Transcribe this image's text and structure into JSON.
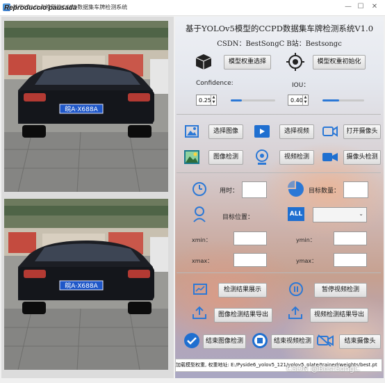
{
  "window": {
    "title": "基于YOLOv5模型的CCPD数据集车牌检测系统",
    "overlay_status": "Reproduccio pausada",
    "controls": {
      "minimize": "—",
      "maximize": "☐",
      "close": "✕"
    }
  },
  "header": {
    "title": "基于YOLOv5模型的CCPD数据集车牌检测系统V1.0",
    "credits": "CSDN：BestSongC   B站：Bestsongc"
  },
  "model": {
    "select_weights_label": "模型权重选择",
    "init_weights_label": "模型权重初始化",
    "confidence_label": "Confidence:",
    "confidence_value": "0.25",
    "confidence_fraction": 0.25,
    "iou_label": "IOU：",
    "iou_value": "0.40",
    "iou_fraction": 0.4
  },
  "source_buttons": {
    "select_image": "选择图像",
    "select_video": "选择视频",
    "open_camera": "打开摄像头",
    "image_detect": "图像检测",
    "video_detect": "视频检测",
    "camera_detect": "摄像头检测"
  },
  "stats": {
    "time_label": "用时：",
    "count_label": "目标数量：",
    "position_label": "目标位置：",
    "all_text": "ALL",
    "combo_value": "",
    "xmin_label": "xmin：",
    "ymin_label": "ymin：",
    "xmax_label": "xmax：",
    "ymax_label": "ymax："
  },
  "actions": {
    "show_results": "检测结果展示",
    "pause_video": "暂停视频检测",
    "export_image": "图像检测结果导出",
    "export_video": "视频检测结果导出",
    "end_image": "结束图像检测",
    "end_video": "结束视频检测",
    "end_camera": "结束摄像头"
  },
  "images": {
    "plate_text_top": "皖A·X688A",
    "plate_text_bottom": "皖A·X688A"
  },
  "status": {
    "text": "加载模型权重, 权重地址: E:/Pyside6_yolov5_121/yolov5_plate/trained/weights/best.pt"
  },
  "watermark": "CSDN @BestSongC",
  "colors": {
    "accent": "#2b78d6",
    "plate": "#1f57c8"
  }
}
